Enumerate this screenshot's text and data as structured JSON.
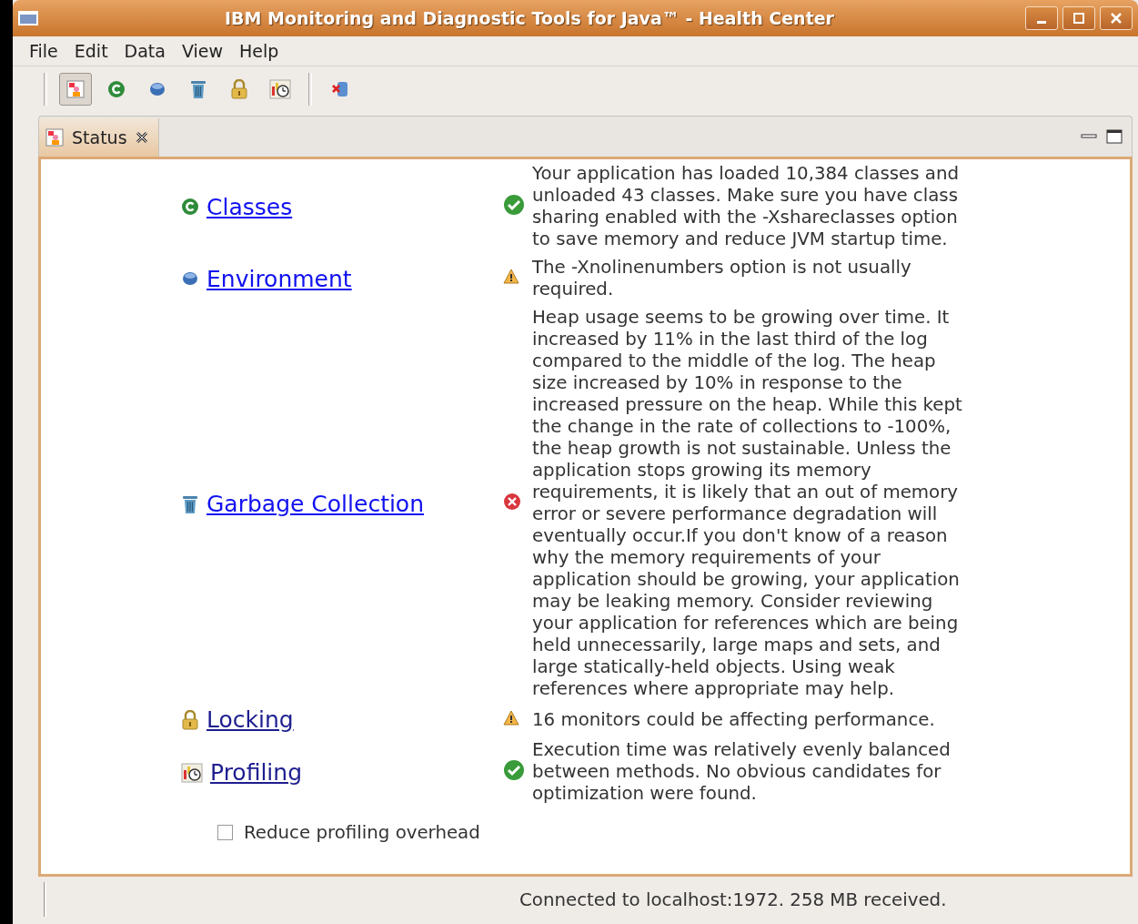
{
  "window": {
    "title": "IBM Monitoring and Diagnostic Tools for Java™ - Health Center"
  },
  "menu": [
    "File",
    "Edit",
    "Data",
    "View",
    "Help"
  ],
  "toolbar": [
    {
      "kind": "status",
      "selected": true
    },
    {
      "kind": "classes",
      "selected": false
    },
    {
      "kind": "environment",
      "selected": false
    },
    {
      "kind": "gc",
      "selected": false
    },
    {
      "kind": "locking",
      "selected": false
    },
    {
      "kind": "profiling",
      "selected": false
    },
    {
      "kind": "disconnect",
      "selected": false
    }
  ],
  "view_tab": {
    "label": "Status",
    "selected": true
  },
  "sections": [
    {
      "kind": "classes",
      "title": "Classes",
      "visited": false,
      "status_icon": {
        "kind": "ok"
      },
      "message": "Your application has loaded 10,384 classes and unloaded 43 classes. Make sure you have class sharing enabled with the -Xshareclasses option to save memory and reduce JVM startup time."
    },
    {
      "kind": "environment",
      "title": "Environment",
      "visited": false,
      "status_icon": {
        "kind": "warning"
      },
      "message": "The -Xnolinenumbers option is not usually required."
    },
    {
      "kind": "gc",
      "title": "Garbage Collection",
      "visited": false,
      "status_icon": {
        "kind": "error"
      },
      "message": "Heap usage seems to be growing over time. It increased by 11% in the last third of the log compared to the middle of the log. The heap size increased by 10% in response to the increased pressure on the heap. While this kept the change in the rate of collections to -100%, the heap growth is not sustainable. Unless the application stops growing its memory requirements, it is likely that an out of memory error or severe performance degradation will eventually occur.If you don't know of a reason why the memory requirements of your application should be growing, your application may be leaking memory. Consider reviewing your application for references which are being held unnecessarily, large maps and sets, and large statically-held objects. Using weak references where appropriate may help."
    },
    {
      "kind": "locking",
      "title": "Locking",
      "visited": true,
      "status_icon": {
        "kind": "warning"
      },
      "message": "16 monitors could be affecting performance."
    },
    {
      "kind": "profiling",
      "title": "Profiling",
      "visited": true,
      "status_icon": {
        "kind": "ok"
      },
      "message": "Execution time was relatively evenly balanced between methods. No obvious candidates for optimization were found."
    }
  ],
  "option": {
    "label": "Reduce profiling overhead",
    "checked": false
  },
  "status_bar": "Connected to localhost:1972. 258 MB received."
}
